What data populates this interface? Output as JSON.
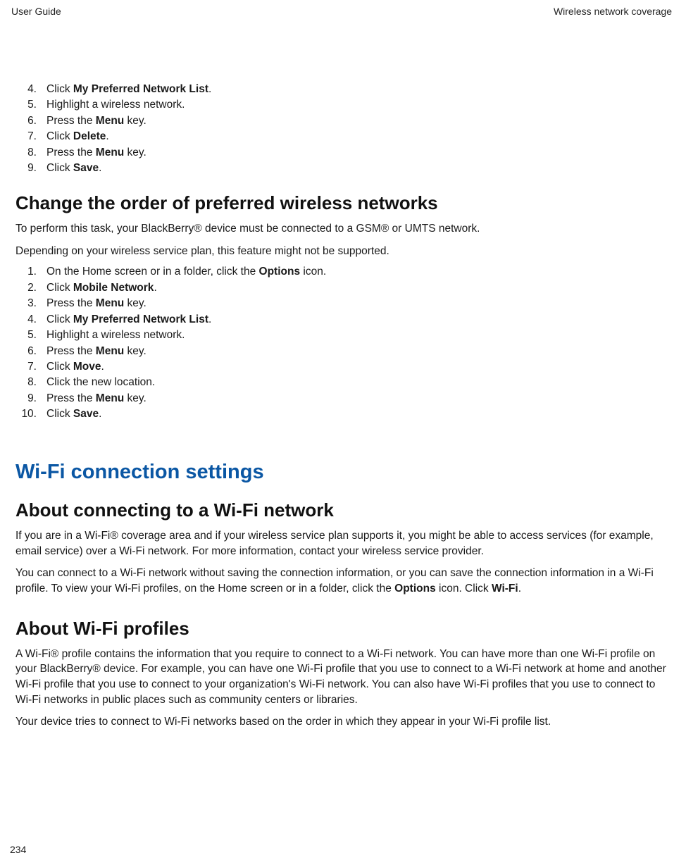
{
  "header": {
    "left": "User Guide",
    "right": "Wireless network coverage"
  },
  "steps_a": [
    {
      "n": "4.",
      "pre": "Click ",
      "bold": "My Preferred Network List",
      "post": "."
    },
    {
      "n": "5.",
      "pre": "Highlight a wireless network.",
      "bold": "",
      "post": ""
    },
    {
      "n": "6.",
      "pre": "Press the ",
      "bold": "Menu",
      "post": " key."
    },
    {
      "n": "7.",
      "pre": "Click ",
      "bold": "Delete",
      "post": "."
    },
    {
      "n": "8.",
      "pre": "Press the ",
      "bold": "Menu",
      "post": " key."
    },
    {
      "n": "9.",
      "pre": "Click ",
      "bold": "Save",
      "post": "."
    }
  ],
  "section1": {
    "title": "Change the order of preferred wireless networks",
    "p1": "To perform this task, your BlackBerry® device must be connected to a GSM® or UMTS network.",
    "p2": "Depending on your wireless service plan, this feature might not be supported."
  },
  "steps_b": [
    {
      "n": "1.",
      "pre": "On the Home screen or in a folder, click the ",
      "bold": "Options",
      "post": " icon."
    },
    {
      "n": "2.",
      "pre": "Click ",
      "bold": "Mobile Network",
      "post": "."
    },
    {
      "n": "3.",
      "pre": "Press the ",
      "bold": "Menu",
      "post": " key."
    },
    {
      "n": "4.",
      "pre": "Click ",
      "bold": "My Preferred Network List",
      "post": "."
    },
    {
      "n": "5.",
      "pre": "Highlight a wireless network.",
      "bold": "",
      "post": ""
    },
    {
      "n": "6.",
      "pre": "Press the ",
      "bold": "Menu",
      "post": " key."
    },
    {
      "n": "7.",
      "pre": "Click ",
      "bold": "Move",
      "post": "."
    },
    {
      "n": "8.",
      "pre": "Click the new location.",
      "bold": "",
      "post": ""
    },
    {
      "n": "9.",
      "pre": "Press the ",
      "bold": "Menu",
      "post": " key."
    },
    {
      "n": "10.",
      "pre": "Click ",
      "bold": "Save",
      "post": "."
    }
  ],
  "h1": "Wi-Fi connection settings",
  "section2": {
    "title": "About connecting to a Wi-Fi network",
    "p1": "If you are in a Wi-Fi® coverage area and if your wireless service plan supports it, you might be able to access services (for example, email service) over a Wi-Fi network. For more information, contact your wireless service provider.",
    "p2_a": "You can connect to a Wi-Fi network without saving the connection information, or you can save the connection information in a Wi-Fi profile. To view your Wi-Fi profiles, on the Home screen or in a folder, click the ",
    "p2_b1": "Options",
    "p2_c": " icon. Click ",
    "p2_b2": "Wi-Fi",
    "p2_d": "."
  },
  "section3": {
    "title": "About Wi-Fi profiles",
    "p1": "A Wi-Fi® profile contains the information that you require to connect to a Wi-Fi network. You can have more than one Wi-Fi profile on your BlackBerry® device. For example, you can have one Wi-Fi profile that you use to connect to a Wi-Fi network at home and another Wi-Fi profile that you use to connect to your organization's Wi-Fi network. You can also have Wi-Fi profiles that you use to connect to Wi-Fi networks in public places such as community centers or libraries.",
    "p2": "Your device tries to connect to Wi-Fi networks based on the order in which they appear in your Wi-Fi profile list."
  },
  "page_number": "234"
}
